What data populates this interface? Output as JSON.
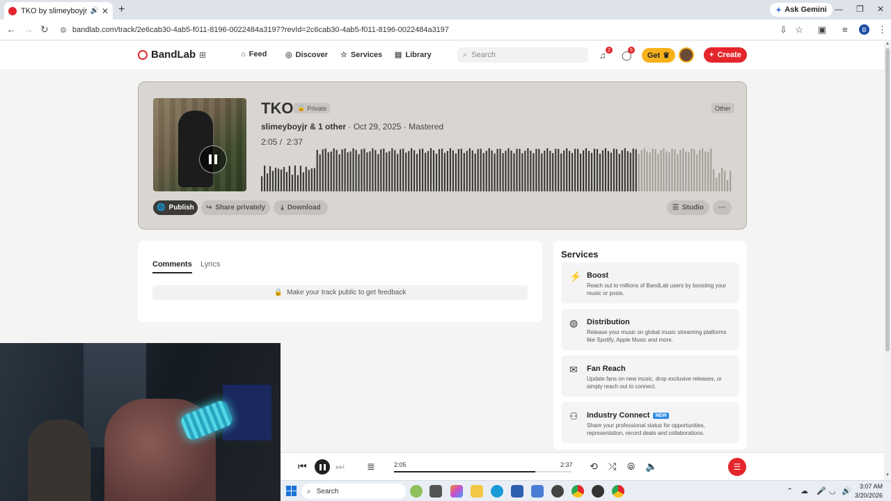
{
  "browser": {
    "tab_title": "TKO by slimeyboyjr | BandL",
    "ask_gemini": "Ask Gemini",
    "url": "bandlab.com/track/2e6cab30-4ab5-f011-8196-0022484a3197?revId=2c6cab30-4ab5-f011-8196-0022484a3197",
    "profile_initial": "B"
  },
  "header": {
    "logo": "BandLab",
    "nav": [
      {
        "label": "Feed",
        "icon": "home-icon"
      },
      {
        "label": "Discover",
        "icon": "compass-icon"
      },
      {
        "label": "Services",
        "icon": "star-icon"
      },
      {
        "label": "Library",
        "icon": "library-icon"
      }
    ],
    "search_placeholder": "Search",
    "notifications_count": "2",
    "messages_count": "5",
    "get_label": "Get",
    "create_label": "Create"
  },
  "track": {
    "title": "TKO",
    "privacy": "Private",
    "genre": "Other",
    "artist": "slimeyboyjr",
    "collab": "& 1 other",
    "date": "· Oct 29, 2025 · Mastered",
    "current_time": "2:05",
    "duration": "2:37",
    "progress": 0.796,
    "buttons": {
      "publish": "Publish",
      "share": "Share privately",
      "download": "Download",
      "studio": "Studio",
      "more": "···"
    }
  },
  "comments": {
    "tabs": [
      "Comments",
      "Lyrics"
    ],
    "notice": "Make your track public to get feedback"
  },
  "services": {
    "title": "Services",
    "items": [
      {
        "name": "Boost",
        "desc": "Reach out to millions of BandLab users by boosting your music or posts.",
        "icon": "bolt-icon"
      },
      {
        "name": "Distribution",
        "desc": "Release your music on global music streaming platforms like Spotify, Apple Music and more.",
        "icon": "distribution-icon"
      },
      {
        "name": "Fan Reach",
        "desc": "Update fans on new music, drop exclusive releases, or simply reach out to connect.",
        "icon": "mail-icon"
      },
      {
        "name": "Industry Connect",
        "badge": "NEW",
        "desc": "Share your professional status for opportunities, representation, record deals and collaborations.",
        "icon": "people-icon"
      }
    ]
  },
  "player": {
    "current_time": "2:05",
    "duration": "2:37",
    "progress": 0.796
  },
  "taskbar": {
    "search": "Search",
    "time": "3:07 AM",
    "date": "3/20/2026"
  },
  "colors": {
    "brand_red": "#e4262c",
    "get_yellow": "#f7b21b",
    "new_blue": "#2e8ae6"
  }
}
